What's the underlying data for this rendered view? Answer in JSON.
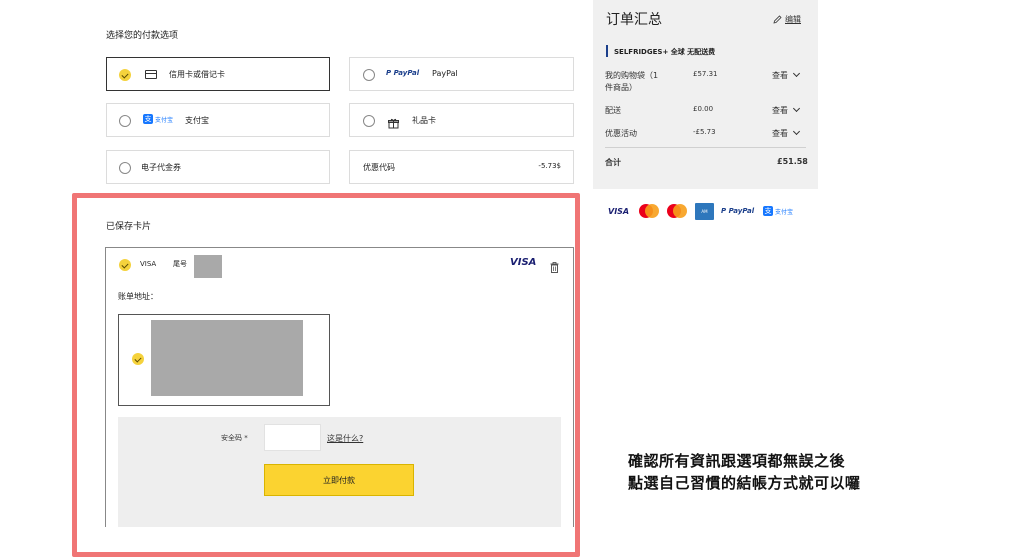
{
  "payment": {
    "title": "选择您的付款选项",
    "options": {
      "card": "信用卡或借记卡",
      "paypal_logo": "PayPal",
      "paypal": "PayPal",
      "alipay_logo": "支付宝",
      "alipay": "支付宝",
      "giftcard": "礼品卡",
      "voucher": "电子代金券",
      "promo": "优惠代码",
      "promo_value": "-5.73$"
    }
  },
  "saved": {
    "title": "已保存卡片",
    "card_brand": "VISA",
    "card_suffix_label": "尾号",
    "visa_logo": "VISA",
    "billing_label": "账单地址：",
    "cvv_label": "安全码 *",
    "cvv_help": "这是什么?",
    "pay_button": "立即付款"
  },
  "summary": {
    "title": "订单汇总",
    "edit": "编辑",
    "shipping_banner": "SELFRIDGES+ 全球 无配送费",
    "bag_label_1": "我的购物袋（1",
    "bag_label_2": "件商品）",
    "bag_value": "£57.31",
    "shipping_label": "配送",
    "shipping_value": "£0.00",
    "discount_label": "优惠活动",
    "discount_value": "-£5.73",
    "view": "查看",
    "total_label": "合计",
    "total_value": "£51.58"
  },
  "pay_icons": {
    "visa": "VISA",
    "paypal": "PayPal",
    "alipay": "支付宝"
  },
  "note": {
    "line1": "確認所有資訊跟選項都無誤之後",
    "line2": "點選自己習慣的結帳方式就可以囉"
  },
  "colors": {
    "accent_yellow": "#fbd330",
    "highlight_red": "#f07575",
    "summary_bg": "#f0f0f0",
    "paypal_blue": "#1b3f8b",
    "alipay_blue": "#1677ff",
    "visa_blue": "#1a1f71"
  }
}
